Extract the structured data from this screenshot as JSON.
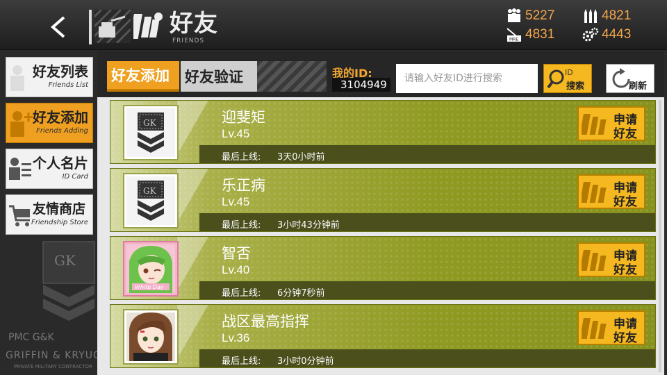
{
  "header": {
    "title_cn": "好友",
    "title_en": "FRIENDS",
    "resources": {
      "manpower": "5227",
      "ammo": "4821",
      "rations": "4831",
      "parts": "4443"
    },
    "rations_icon_label": "MRE"
  },
  "sidebar": {
    "items": [
      {
        "cn": "好友列表",
        "en": "Friends List"
      },
      {
        "cn": "好友添加",
        "en": "Friends Adding"
      },
      {
        "cn": "个人名片",
        "en": "ID Card"
      },
      {
        "cn": "友情商店",
        "en": "Friendship Store"
      }
    ],
    "active_index": 1,
    "brand": {
      "line1": "PMC G&K",
      "line2": "GRIFFIN & KRYUGER",
      "line3": "PRIVATE MILITARY CONTRACTOR"
    }
  },
  "tabs": {
    "adding": "好友添加",
    "verify": "好友验证",
    "active": "adding"
  },
  "my_id": {
    "label": "我的ID:",
    "value": "3104949"
  },
  "search": {
    "placeholder": "请输入好友ID进行搜索",
    "value": "",
    "button_id": "ID",
    "button_label": "搜索"
  },
  "refresh": {
    "label": "刷新"
  },
  "friends": [
    {
      "name": "迎斐矩",
      "level": "Lv.45",
      "last_online_label": "最后上线:",
      "last_online": "3天0小时前",
      "avatar": "gk-badge",
      "apply_line1": "申请",
      "apply_line2": "好友"
    },
    {
      "name": "乐正病",
      "level": "Lv.45",
      "last_online_label": "最后上线:",
      "last_online": "3小时43分钟前",
      "avatar": "gk-badge",
      "apply_line1": "申请",
      "apply_line2": "好友"
    },
    {
      "name": "智否",
      "level": "Lv.40",
      "last_online_label": "最后上线:",
      "last_online": "6分钟7秒前",
      "avatar": "green-hair-girl",
      "avatar_text": "White Day",
      "apply_line1": "申请",
      "apply_line2": "好友"
    },
    {
      "name": "战区最高指挥",
      "level": "Lv.36",
      "last_online_label": "最后上线:",
      "last_online": "3小时0分钟前",
      "avatar": "brown-hair-girl",
      "apply_line1": "申请",
      "apply_line2": "好友"
    }
  ],
  "colors": {
    "accent_orange": "#f0a020",
    "resource_text": "#f3a64a",
    "card_olive": "#8f9a22",
    "button_yellow": "#f6b820"
  }
}
